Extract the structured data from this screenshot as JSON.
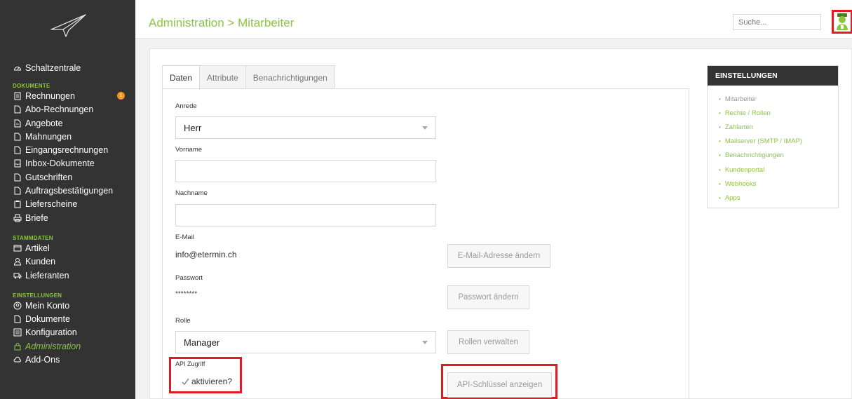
{
  "header": {
    "title": "Administration > Mitarbeiter",
    "search_placeholder": "Suche..."
  },
  "sidebar": {
    "dashboard": "Schaltzentrale",
    "sections": {
      "documents": "DOKUMENTE",
      "master_data": "STAMMDATEN",
      "settings": "EINSTELLUNGEN"
    },
    "documents": [
      {
        "label": "Rechnungen",
        "icon": "invoice-icon"
      },
      {
        "label": "Abo-Rechnungen",
        "icon": "document-icon"
      },
      {
        "label": "Angebote",
        "icon": "document-icon"
      },
      {
        "label": "Mahnungen",
        "icon": "document-icon"
      },
      {
        "label": "Eingangsrechnungen",
        "icon": "document-icon"
      },
      {
        "label": "Inbox-Dokumente",
        "icon": "inbox-icon"
      },
      {
        "label": "Gutschriften",
        "icon": "document-icon"
      },
      {
        "label": "Auftragsbestätigungen",
        "icon": "document-icon"
      },
      {
        "label": "Lieferscheine",
        "icon": "clipboard-icon"
      },
      {
        "label": "Briefe",
        "icon": "printer-icon"
      }
    ],
    "invoice_badge": "1",
    "master": [
      {
        "label": "Artikel"
      },
      {
        "label": "Kunden"
      },
      {
        "label": "Lieferanten"
      }
    ],
    "settings": [
      {
        "label": "Mein Konto"
      },
      {
        "label": "Dokumente"
      },
      {
        "label": "Konfiguration"
      },
      {
        "label": "Administration"
      },
      {
        "label": "Add-Ons"
      }
    ]
  },
  "tabs": [
    "Daten",
    "Attribute",
    "Benachrichtigungen"
  ],
  "form": {
    "salutation_label": "Anrede",
    "salutation_value": "Herr",
    "firstname_label": "Vorname",
    "lastname_label": "Nachname",
    "email_label": "E-Mail",
    "email_value": "info@etermin.ch",
    "change_email_button": "E-Mail-Adresse ändern",
    "password_label": "Passwort",
    "password_value": "********",
    "change_password_button": "Passwort ändern",
    "role_label": "Rolle",
    "role_value": "Manager",
    "manage_roles_button": "Rollen verwalten",
    "api_label": "API Zugriff",
    "api_checkbox_label": "aktivieren?",
    "api_checked": true,
    "api_key_button": "API-Schlüssel anzeigen"
  },
  "settings_widget": {
    "title": "EINSTELLUNGEN",
    "items": [
      "Mitarbeiter",
      "Rechte / Rollen",
      "Zahlarten",
      "Mailserver (SMTP / IMAP)",
      "Benachrichtigungen",
      "Kundenportal",
      "Webhooks",
      "Apps"
    ]
  },
  "colors": {
    "accent": "#8cc63f",
    "sidebar": "#333333",
    "highlight": "#e21b23",
    "badge": "#f7941d"
  }
}
